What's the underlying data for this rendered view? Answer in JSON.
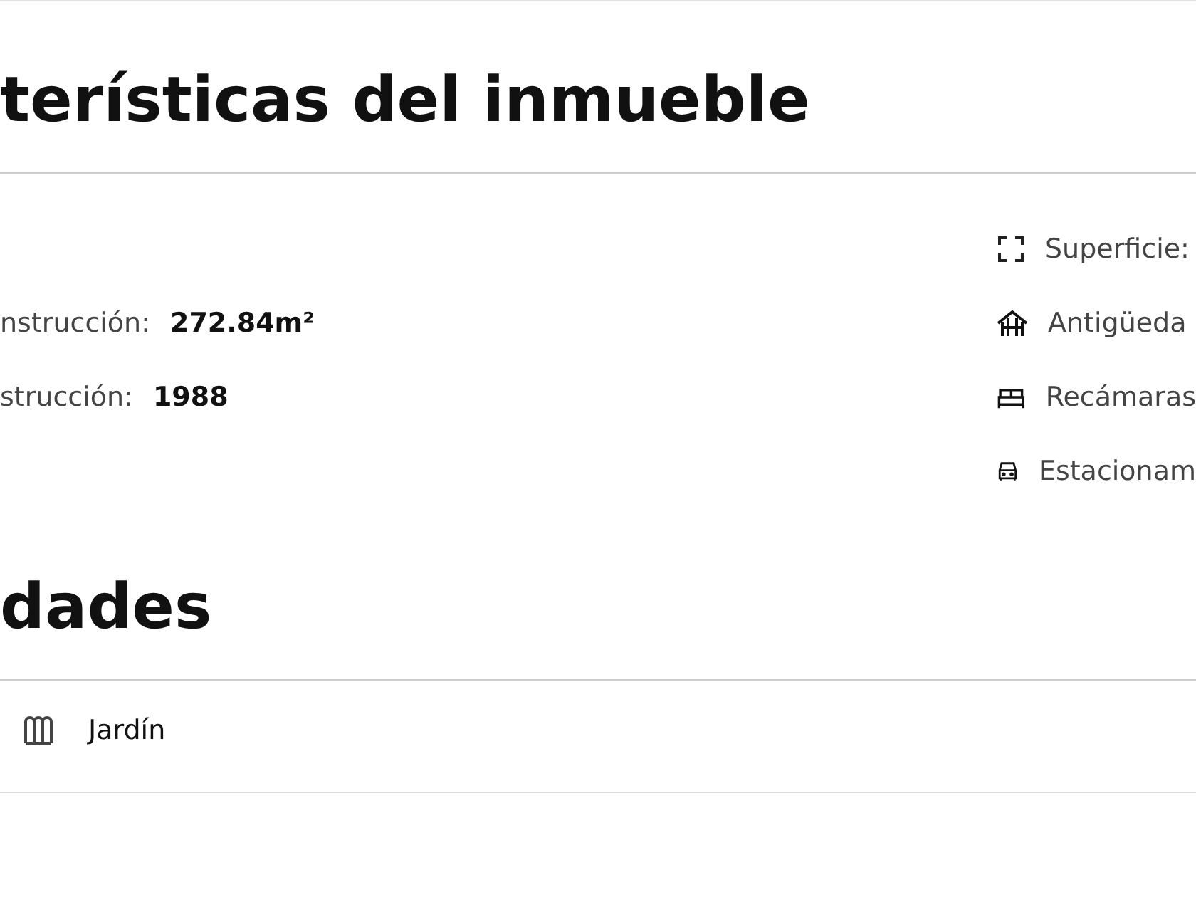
{
  "sections": [
    {
      "title": "terísticas del inmueble",
      "left_features": [
        {
          "label": "nstrucción:",
          "value": "272.84m²"
        },
        {
          "label": "strucción:",
          "value": "1988"
        }
      ],
      "right_features": [
        {
          "kind": "area",
          "label": "Superficie:"
        },
        {
          "kind": "age",
          "label": "Antigüeda"
        },
        {
          "kind": "bed",
          "label": "Recámaras"
        },
        {
          "kind": "car",
          "label": "Estacionam"
        }
      ]
    },
    {
      "title": "dades",
      "amenities": [
        {
          "kind": "garden",
          "label": "Jardín"
        }
      ]
    }
  ]
}
